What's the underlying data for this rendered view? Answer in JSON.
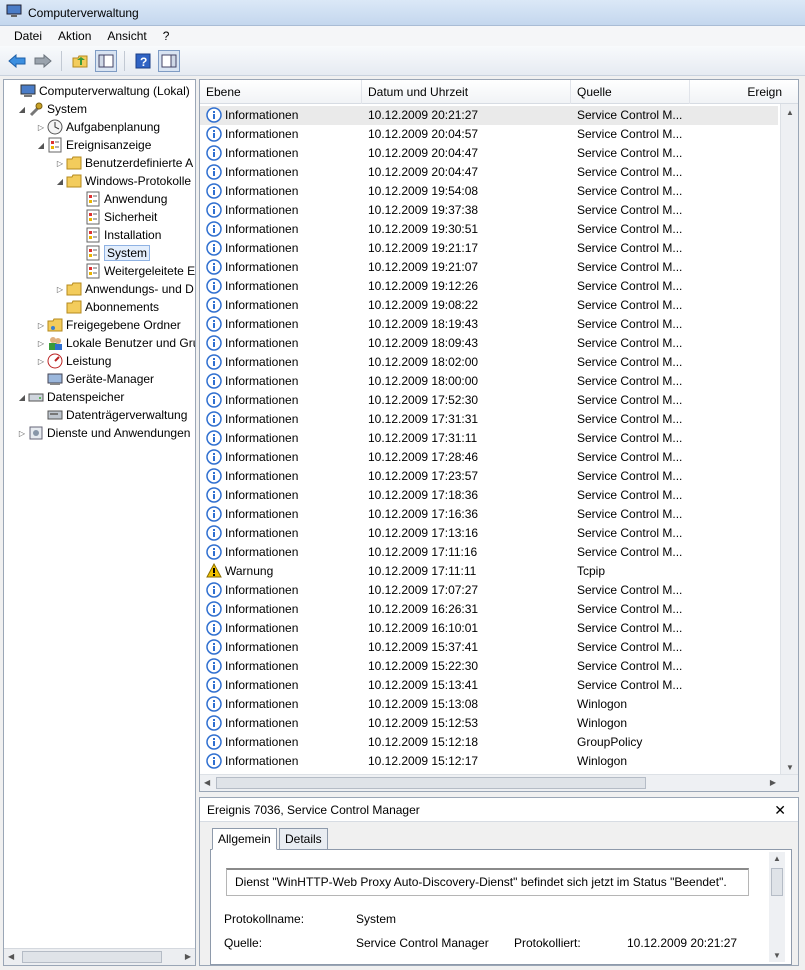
{
  "window": {
    "title": "Computerverwaltung"
  },
  "menu": [
    "Datei",
    "Aktion",
    "Ansicht",
    "?"
  ],
  "tree": [
    {
      "label": "Computerverwaltung (Lokal)",
      "indent": 0,
      "expander": "",
      "icon": "computer-icon"
    },
    {
      "label": "System",
      "indent": 1,
      "expander": "◢",
      "icon": "tools-icon"
    },
    {
      "label": "Aufgabenplanung",
      "indent": 2,
      "expander": "▷",
      "icon": "clock-icon"
    },
    {
      "label": "Ereignisanzeige",
      "indent": 2,
      "expander": "◢",
      "icon": "event-viewer-icon"
    },
    {
      "label": "Benutzerdefinierte A",
      "indent": 3,
      "expander": "▷",
      "icon": "folder-icon"
    },
    {
      "label": "Windows-Protokolle",
      "indent": 3,
      "expander": "◢",
      "icon": "folder-icon"
    },
    {
      "label": "Anwendung",
      "indent": 4,
      "expander": "",
      "icon": "log-icon"
    },
    {
      "label": "Sicherheit",
      "indent": 4,
      "expander": "",
      "icon": "log-icon"
    },
    {
      "label": "Installation",
      "indent": 4,
      "expander": "",
      "icon": "log-icon"
    },
    {
      "label": "System",
      "indent": 4,
      "expander": "",
      "icon": "log-icon",
      "selected": true
    },
    {
      "label": "Weitergeleitete E",
      "indent": 4,
      "expander": "",
      "icon": "log-icon"
    },
    {
      "label": "Anwendungs- und D",
      "indent": 3,
      "expander": "▷",
      "icon": "folder-icon"
    },
    {
      "label": "Abonnements",
      "indent": 3,
      "expander": "",
      "icon": "folder-icon"
    },
    {
      "label": "Freigegebene Ordner",
      "indent": 2,
      "expander": "▷",
      "icon": "shared-folder-icon"
    },
    {
      "label": "Lokale Benutzer und Gru",
      "indent": 2,
      "expander": "▷",
      "icon": "users-icon"
    },
    {
      "label": "Leistung",
      "indent": 2,
      "expander": "▷",
      "icon": "performance-icon"
    },
    {
      "label": "Geräte-Manager",
      "indent": 2,
      "expander": "",
      "icon": "device-manager-icon"
    },
    {
      "label": "Datenspeicher",
      "indent": 1,
      "expander": "◢",
      "icon": "storage-icon"
    },
    {
      "label": "Datenträgerverwaltung",
      "indent": 2,
      "expander": "",
      "icon": "disk-icon"
    },
    {
      "label": "Dienste und Anwendungen",
      "indent": 1,
      "expander": "▷",
      "icon": "services-icon"
    }
  ],
  "columns": {
    "ebene": "Ebene",
    "datum": "Datum und Uhrzeit",
    "quelle": "Quelle",
    "ereignis": "Ereign"
  },
  "events": [
    {
      "level": "Informationen",
      "type": "info",
      "date": "10.12.2009 20:21:27",
      "source": "Service Control M..."
    },
    {
      "level": "Informationen",
      "type": "info",
      "date": "10.12.2009 20:04:57",
      "source": "Service Control M..."
    },
    {
      "level": "Informationen",
      "type": "info",
      "date": "10.12.2009 20:04:47",
      "source": "Service Control M..."
    },
    {
      "level": "Informationen",
      "type": "info",
      "date": "10.12.2009 20:04:47",
      "source": "Service Control M..."
    },
    {
      "level": "Informationen",
      "type": "info",
      "date": "10.12.2009 19:54:08",
      "source": "Service Control M..."
    },
    {
      "level": "Informationen",
      "type": "info",
      "date": "10.12.2009 19:37:38",
      "source": "Service Control M..."
    },
    {
      "level": "Informationen",
      "type": "info",
      "date": "10.12.2009 19:30:51",
      "source": "Service Control M..."
    },
    {
      "level": "Informationen",
      "type": "info",
      "date": "10.12.2009 19:21:17",
      "source": "Service Control M..."
    },
    {
      "level": "Informationen",
      "type": "info",
      "date": "10.12.2009 19:21:07",
      "source": "Service Control M..."
    },
    {
      "level": "Informationen",
      "type": "info",
      "date": "10.12.2009 19:12:26",
      "source": "Service Control M..."
    },
    {
      "level": "Informationen",
      "type": "info",
      "date": "10.12.2009 19:08:22",
      "source": "Service Control M..."
    },
    {
      "level": "Informationen",
      "type": "info",
      "date": "10.12.2009 18:19:43",
      "source": "Service Control M..."
    },
    {
      "level": "Informationen",
      "type": "info",
      "date": "10.12.2009 18:09:43",
      "source": "Service Control M..."
    },
    {
      "level": "Informationen",
      "type": "info",
      "date": "10.12.2009 18:02:00",
      "source": "Service Control M..."
    },
    {
      "level": "Informationen",
      "type": "info",
      "date": "10.12.2009 18:00:00",
      "source": "Service Control M..."
    },
    {
      "level": "Informationen",
      "type": "info",
      "date": "10.12.2009 17:52:30",
      "source": "Service Control M..."
    },
    {
      "level": "Informationen",
      "type": "info",
      "date": "10.12.2009 17:31:31",
      "source": "Service Control M..."
    },
    {
      "level": "Informationen",
      "type": "info",
      "date": "10.12.2009 17:31:11",
      "source": "Service Control M..."
    },
    {
      "level": "Informationen",
      "type": "info",
      "date": "10.12.2009 17:28:46",
      "source": "Service Control M..."
    },
    {
      "level": "Informationen",
      "type": "info",
      "date": "10.12.2009 17:23:57",
      "source": "Service Control M..."
    },
    {
      "level": "Informationen",
      "type": "info",
      "date": "10.12.2009 17:18:36",
      "source": "Service Control M..."
    },
    {
      "level": "Informationen",
      "type": "info",
      "date": "10.12.2009 17:16:36",
      "source": "Service Control M..."
    },
    {
      "level": "Informationen",
      "type": "info",
      "date": "10.12.2009 17:13:16",
      "source": "Service Control M..."
    },
    {
      "level": "Informationen",
      "type": "info",
      "date": "10.12.2009 17:11:16",
      "source": "Service Control M..."
    },
    {
      "level": "Warnung",
      "type": "warning",
      "date": "10.12.2009 17:11:11",
      "source": "Tcpip"
    },
    {
      "level": "Informationen",
      "type": "info",
      "date": "10.12.2009 17:07:27",
      "source": "Service Control M..."
    },
    {
      "level": "Informationen",
      "type": "info",
      "date": "10.12.2009 16:26:31",
      "source": "Service Control M..."
    },
    {
      "level": "Informationen",
      "type": "info",
      "date": "10.12.2009 16:10:01",
      "source": "Service Control M..."
    },
    {
      "level": "Informationen",
      "type": "info",
      "date": "10.12.2009 15:37:41",
      "source": "Service Control M..."
    },
    {
      "level": "Informationen",
      "type": "info",
      "date": "10.12.2009 15:22:30",
      "source": "Service Control M..."
    },
    {
      "level": "Informationen",
      "type": "info",
      "date": "10.12.2009 15:13:41",
      "source": "Service Control M..."
    },
    {
      "level": "Informationen",
      "type": "info",
      "date": "10.12.2009 15:13:08",
      "source": "Winlogon"
    },
    {
      "level": "Informationen",
      "type": "info",
      "date": "10.12.2009 15:12:53",
      "source": "Winlogon"
    },
    {
      "level": "Informationen",
      "type": "info",
      "date": "10.12.2009 15:12:18",
      "source": "GroupPolicy"
    },
    {
      "level": "Informationen",
      "type": "info",
      "date": "10.12.2009 15:12:17",
      "source": "Winlogon"
    }
  ],
  "detail": {
    "title": "Ereignis 7036, Service Control Manager",
    "close": "✕",
    "tabs": {
      "general": "Allgemein",
      "details": "Details"
    },
    "message": "Dienst \"WinHTTP-Web Proxy Auto-Discovery-Dienst\" befindet sich jetzt im Status \"Beendet\".",
    "log_name_label": "Protokollname:",
    "log_name": "System",
    "source_label": "Quelle:",
    "source": "Service Control Manager",
    "logged_label": "Protokolliert:",
    "logged": "10.12.2009 20:21:27"
  },
  "colors": {
    "info": "#2f6fd0",
    "warning": "#f2c200",
    "selection": "#e3eefc"
  }
}
